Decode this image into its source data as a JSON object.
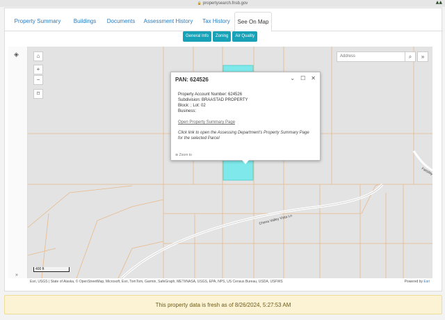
{
  "browser": {
    "url": "propertysearch.fnsb.gov"
  },
  "tabs": [
    {
      "label": "Property Summary"
    },
    {
      "label": "Buildings"
    },
    {
      "label": "Documents"
    },
    {
      "label": "Assessment History"
    },
    {
      "label": "Tax History"
    },
    {
      "label": "See On Map"
    }
  ],
  "active_tab": "See On Map",
  "map_buttons": {
    "general_info": "General Info",
    "zoning": "Zoning",
    "air_quality": "Air Quality"
  },
  "search": {
    "placeholder": "Address"
  },
  "popup": {
    "title": "PAN: 624526",
    "account_line": "Property Account Number: 624526",
    "subdivision_line": "Subdivision: BRAASTAD PROPERTY",
    "block_lot_line": "Block: ; Lot: 02",
    "business_line": "Business:",
    "link_text": "Open Property Summary Page",
    "note": "Click link to open the Assessing Department's Property Summary Page for the selected Parcel",
    "zoom_to": "Zoom to"
  },
  "map_labels": {
    "road1": "Chena Valley Vista Ln",
    "road2": "Fairplay"
  },
  "scale": "400 ft",
  "attribution": "Esri, USGS | State of Alaska, © OpenStreetMap, Microsoft, Esri, TomTom, Garmin, SafeGraph, METI/NASA, USGS, EPA, NPS, US Census Bureau, USDA, USFWS",
  "powered_by_prefix": "Powered by",
  "powered_by_brand": "Esri",
  "freshness": "This property data is fresh as of 8/26/2024, 5:27:53 AM",
  "colors": {
    "accent": "#17a2b8",
    "parcel_line": "#e8b98a",
    "selected_parcel": "#7ee8ea",
    "link": "#2a7bbf"
  }
}
